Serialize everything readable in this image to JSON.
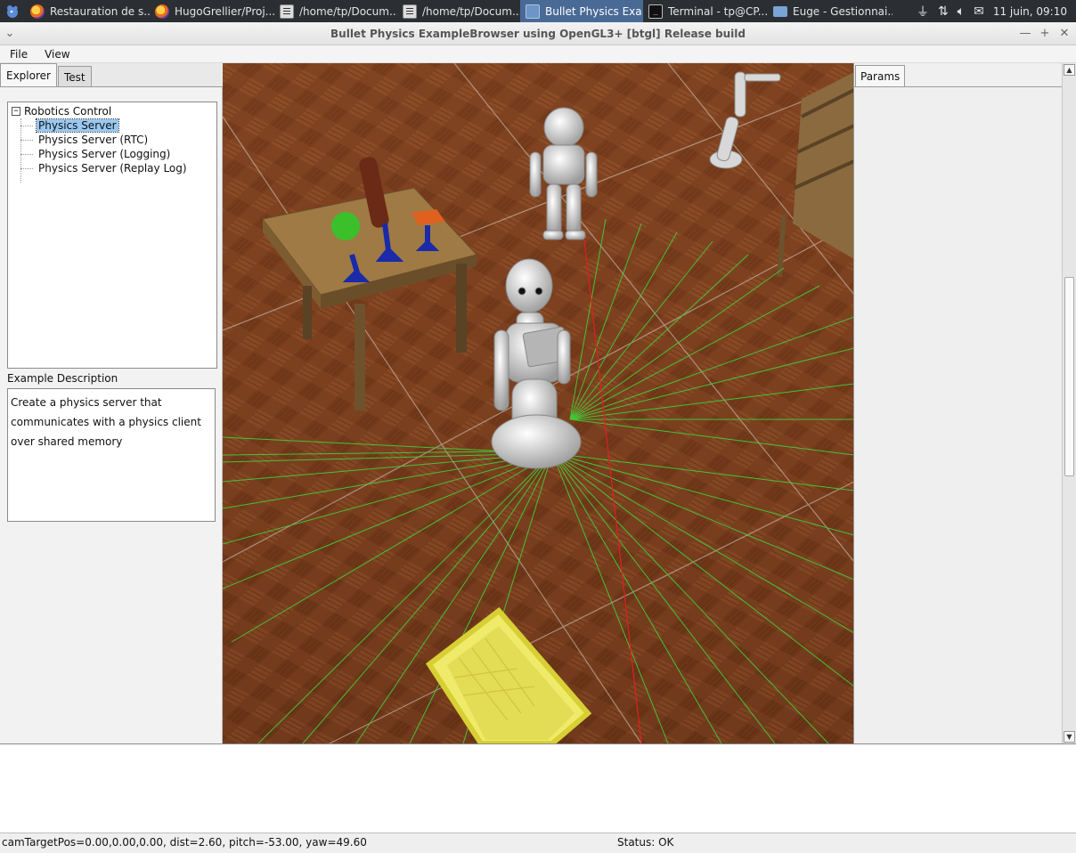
{
  "taskbar": {
    "tasks": [
      {
        "label": "Restauration de s...",
        "icon": "firefox-icon"
      },
      {
        "label": "HugoGrellier/Proj...",
        "icon": "firefox-icon"
      },
      {
        "label": "/home/tp/Docum...",
        "icon": "text-editor-icon"
      },
      {
        "label": "/home/tp/Docum...",
        "icon": "text-editor-icon"
      },
      {
        "label": "Bullet Physics Exa...",
        "icon": "bullet-app-icon"
      },
      {
        "label": "Terminal - tp@CP...",
        "icon": "terminal-icon"
      },
      {
        "label": "Euge - Gestionnai...",
        "icon": "folder-icon"
      }
    ],
    "clock": "11 juin, 09:10",
    "accent": "#4a6a96"
  },
  "window": {
    "title": "Bullet Physics ExampleBrowser using OpenGL3+ [btgl] Release build"
  },
  "menu": {
    "file": "File",
    "view": "View"
  },
  "left": {
    "tabs": {
      "explorer": "Explorer",
      "test": "Test"
    },
    "tree": {
      "root": "Robotics Control",
      "toggle": "⊟",
      "items": [
        "Physics Server",
        "Physics Server (RTC)",
        "Physics Server (Logging)",
        "Physics Server (Replay Log)"
      ],
      "selected_index": 0
    },
    "description_label": "Example Description",
    "description": [
      "Create a physics server that",
      "communicates with a physics client",
      "over shared memory"
    ]
  },
  "right": {
    "tab": "Params"
  },
  "statusbar": {
    "camera": "camTargetPos=0.00,0.00,0.00, dist=2.60, pitch=-53.00, yaw=49.60",
    "status": "Status: OK"
  }
}
